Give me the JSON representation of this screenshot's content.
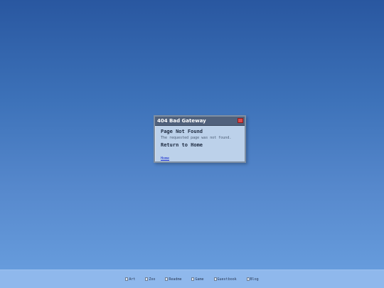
{
  "dialog": {
    "title": "404 Bad Gateway",
    "heading": "Page Not Found",
    "message": "The requested page was not found.",
    "return_heading": "Return to Home",
    "home_link": "Home"
  },
  "footer": {
    "links": [
      {
        "label": "Art",
        "icon": "broken-image-icon"
      },
      {
        "label": "Zoo",
        "icon": "broken-image-icon"
      },
      {
        "label": "Readme",
        "icon": "broken-image-icon"
      },
      {
        "label": "Game",
        "icon": "broken-image-icon"
      },
      {
        "label": "Guestbook",
        "icon": "broken-image-icon"
      },
      {
        "label": "Blog",
        "icon": "broken-image-icon"
      }
    ]
  },
  "colors": {
    "titlebar": "#50617c",
    "dialog_bg": "#bcd1ea",
    "close_button": "#d94a4a",
    "link": "#1a2fd0",
    "footer_bg": "#8fb8ec"
  }
}
